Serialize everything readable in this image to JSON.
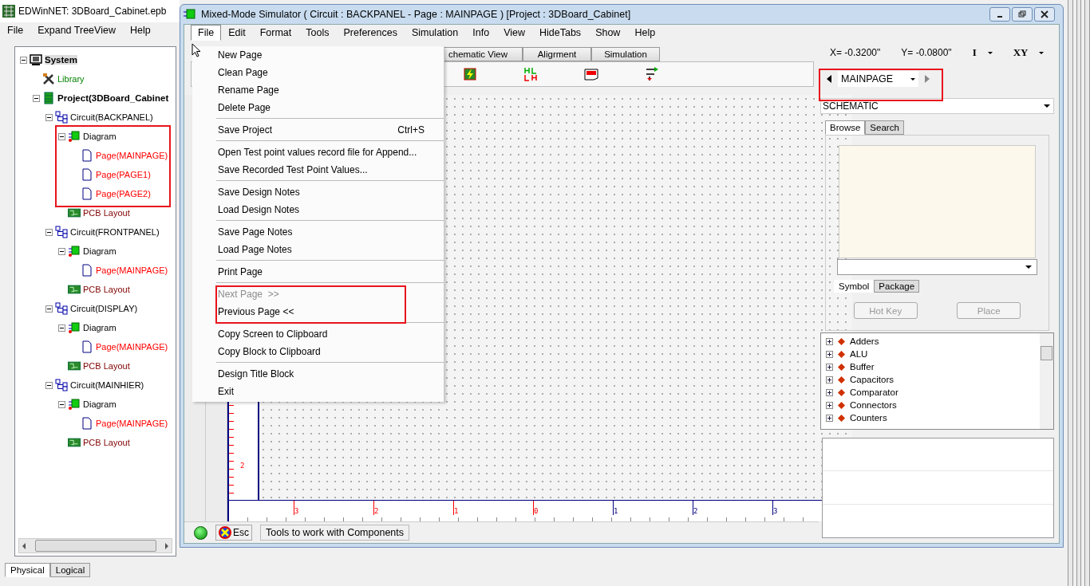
{
  "explorer": {
    "title": "EDWinNET: 3DBoard_Cabinet.epb",
    "menu": [
      "File",
      "Expand TreeView",
      "Help"
    ],
    "tree": [
      {
        "label": "System",
        "kind": "system",
        "selected": true,
        "expanded": true,
        "children": [
          {
            "label": "Library",
            "kind": "library",
            "selected": false
          },
          {
            "label": "Project(3DBoard_Cabinet",
            "kind": "project",
            "selected": false,
            "expanded": true,
            "children": [
              {
                "label": "Circuit(BACKPANEL)",
                "kind": "circuit",
                "selected": false,
                "expanded": true,
                "children": [
                  {
                    "label": "Diagram",
                    "kind": "diagram",
                    "selected": false,
                    "expanded": true,
                    "children": [
                      {
                        "label": "Page(MAINPAGE)",
                        "kind": "page",
                        "selected": false
                      },
                      {
                        "label": "Page(PAGE1)",
                        "kind": "page",
                        "selected": false
                      },
                      {
                        "label": "Page(PAGE2)",
                        "kind": "page",
                        "selected": false
                      }
                    ]
                  },
                  {
                    "label": "PCB Layout",
                    "kind": "pcb",
                    "selected": false
                  }
                ]
              },
              {
                "label": "Circuit(FRONTPANEL)",
                "kind": "circuit",
                "selected": false,
                "expanded": true,
                "children": [
                  {
                    "label": "Diagram",
                    "kind": "diagram",
                    "selected": false,
                    "expanded": true,
                    "children": [
                      {
                        "label": "Page(MAINPAGE)",
                        "kind": "page",
                        "selected": false
                      }
                    ]
                  },
                  {
                    "label": "PCB Layout",
                    "kind": "pcb",
                    "selected": false
                  }
                ]
              },
              {
                "label": "Circuit(DISPLAY)",
                "kind": "circuit",
                "selected": false,
                "expanded": true,
                "children": [
                  {
                    "label": "Diagram",
                    "kind": "diagram",
                    "selected": false,
                    "expanded": true,
                    "children": [
                      {
                        "label": "Page(MAINPAGE)",
                        "kind": "page",
                        "selected": false
                      }
                    ]
                  },
                  {
                    "label": "PCB Layout",
                    "kind": "pcb",
                    "selected": false
                  }
                ]
              },
              {
                "label": "Circuit(MAINHIER)",
                "kind": "circuit",
                "selected": false,
                "expanded": true,
                "children": [
                  {
                    "label": "Diagram",
                    "kind": "diagram",
                    "selected": false,
                    "expanded": true,
                    "children": [
                      {
                        "label": "Page(MAINPAGE)",
                        "kind": "page",
                        "selected": false
                      }
                    ]
                  },
                  {
                    "label": "PCB Layout",
                    "kind": "pcb",
                    "selected": false
                  }
                ]
              }
            ]
          }
        ]
      }
    ],
    "tabs": [
      {
        "label": "Physical",
        "selected": true
      },
      {
        "label": "Logical",
        "selected": false
      }
    ]
  },
  "simulator": {
    "title": "Mixed-Mode Simulator ( Circuit : BACKPANEL - Page : MAINPAGE ) [Project : 3DBoard_Cabinet]",
    "menu": [
      {
        "label": "File",
        "selected": true
      },
      {
        "label": "Edit",
        "selected": false
      },
      {
        "label": "Format",
        "selected": false
      },
      {
        "label": "Tools",
        "selected": false
      },
      {
        "label": "Preferences",
        "selected": false
      },
      {
        "label": "Simulation",
        "selected": false
      },
      {
        "label": "Info",
        "selected": false
      },
      {
        "label": "View",
        "selected": false
      },
      {
        "label": "HideTabs",
        "selected": false
      },
      {
        "label": "Show",
        "selected": false
      },
      {
        "label": "Help",
        "selected": false
      }
    ],
    "file_menu": [
      [
        {
          "label": "New Page",
          "disabled": false
        },
        {
          "label": "Clean Page",
          "disabled": false
        },
        {
          "label": "Rename Page",
          "disabled": false
        },
        {
          "label": "Delete Page",
          "disabled": false
        }
      ],
      [
        {
          "label": "Save Project",
          "shortcut": "Ctrl+S",
          "disabled": false
        }
      ],
      [
        {
          "label": "Open Test point values record file for Append...",
          "disabled": false
        },
        {
          "label": "Save Recorded Test Point Values...",
          "disabled": false
        }
      ],
      [
        {
          "label": "Save Design Notes",
          "disabled": false
        },
        {
          "label": "Load Design Notes",
          "disabled": false
        }
      ],
      [
        {
          "label": "Save Page Notes",
          "disabled": false
        },
        {
          "label": "Load Page Notes",
          "disabled": false
        }
      ],
      [
        {
          "label": "Print Page",
          "disabled": false
        }
      ],
      [
        {
          "label": "Next Page  >>",
          "disabled": true
        },
        {
          "label": "Previous Page <<",
          "disabled": false
        }
      ],
      [
        {
          "label": "Copy Screen to Clipboard",
          "disabled": false
        },
        {
          "label": "Copy Block to Clipboard",
          "disabled": false
        }
      ],
      [
        {
          "label": "Design Title Block",
          "disabled": false
        },
        {
          "label": "Exit",
          "disabled": false
        }
      ]
    ],
    "view_tabs": [
      "chematic View",
      "Aligrment",
      "Simulation"
    ],
    "coordinates": {
      "x": "X= -0.3200\"",
      "y": "Y= -0.0800\"",
      "unit": "I",
      "mode": "XY"
    },
    "page_nav": {
      "page": "MAINPAGE"
    },
    "view_select": "SCHEMATIC",
    "browser_tabs": [
      {
        "label": "Browse",
        "selected": true
      },
      {
        "label": "Search",
        "selected": false
      }
    ],
    "symbol_tabs": [
      {
        "label": "Symbol",
        "selected": true
      },
      {
        "label": "Package",
        "selected": false
      }
    ],
    "buttons": [
      {
        "label": "Hot Key",
        "disabled": true
      },
      {
        "label": "Place",
        "disabled": true
      }
    ],
    "components": [
      "Adders",
      "ALU",
      "Buffer",
      "Capacitors",
      "Comparator",
      "Connectors",
      "Counters"
    ],
    "vertical_ruler": [
      {
        "label": "2",
        "color": "#ff0000"
      }
    ],
    "horizontal_ruler": [
      {
        "label": "3",
        "color": "#ff0000"
      },
      {
        "label": "2",
        "color": "#ff0000"
      },
      {
        "label": "1",
        "color": "#ff0000"
      },
      {
        "label": "0",
        "color": "#ff0000"
      },
      {
        "label": "1",
        "color": "#000080"
      },
      {
        "label": "2",
        "color": "#000080"
      },
      {
        "label": "3",
        "color": "#000080"
      }
    ],
    "status": {
      "esc": "Esc",
      "message": "Tools to work with Components"
    }
  }
}
